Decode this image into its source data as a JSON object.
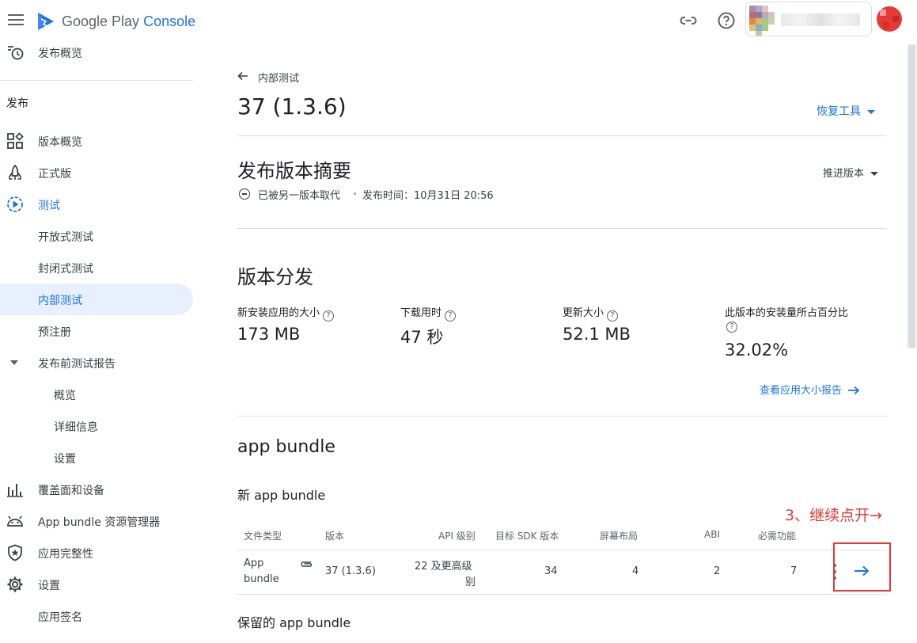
{
  "header": {
    "brand_main": "Google Play",
    "brand_accent": "Console"
  },
  "sidebar": {
    "top_item": "发布概览",
    "section": "发布",
    "items": [
      {
        "label": "版本概览"
      },
      {
        "label": "正式版"
      },
      {
        "label": "测试"
      },
      {
        "label": "开放式测试"
      },
      {
        "label": "封闭式测试"
      },
      {
        "label": "内部测试"
      },
      {
        "label": "预注册"
      },
      {
        "label": "发布前测试报告"
      },
      {
        "label": "概览"
      },
      {
        "label": "详细信息"
      },
      {
        "label": "设置"
      },
      {
        "label": "覆盖面和设备"
      },
      {
        "label": "App bundle 资源管理器"
      },
      {
        "label": "应用完整性"
      },
      {
        "label": "设置"
      },
      {
        "label": "应用签名"
      }
    ]
  },
  "main": {
    "back_label": "内部测试",
    "title": "37 (1.3.6)",
    "recover_tools": "恢复工具",
    "summary_title": "发布版本摘要",
    "promote": "推进版本",
    "status_text": "已被另一版本取代",
    "release_time": "发布时间：10月31日 20:56",
    "distribution_title": "版本分发",
    "stats": [
      {
        "label": "新安装应用的大小",
        "value": "173 MB"
      },
      {
        "label": "下载用时",
        "value": "47 秒"
      },
      {
        "label": "更新大小",
        "value": "52.1 MB"
      },
      {
        "label": "此版本的安装量所占百分比",
        "value": "32.02%"
      }
    ],
    "size_report_link": "查看应用大小报告",
    "bundle_title": "app bundle",
    "new_bundle_title": "新 app bundle",
    "table": {
      "headers": [
        "文件类型",
        "版本",
        "API 级别",
        "目标 SDK 版本",
        "屏幕布局",
        "ABI",
        "必需功能"
      ],
      "row": {
        "type_line1": "App",
        "type_line2": "bundle",
        "version": "37 (1.3.6)",
        "api_line1": "22 及更高级",
        "api_line2": "别",
        "target_sdk": "34",
        "screen": "4",
        "abi": "2",
        "features": "7"
      }
    },
    "retained_title": "保留的 app bundle"
  },
  "annotation": {
    "text": "3、继续点开→"
  },
  "colors": {
    "accent": "#1a73e8",
    "annotation": "#e53935",
    "active_bg": "#e8f0fe"
  }
}
